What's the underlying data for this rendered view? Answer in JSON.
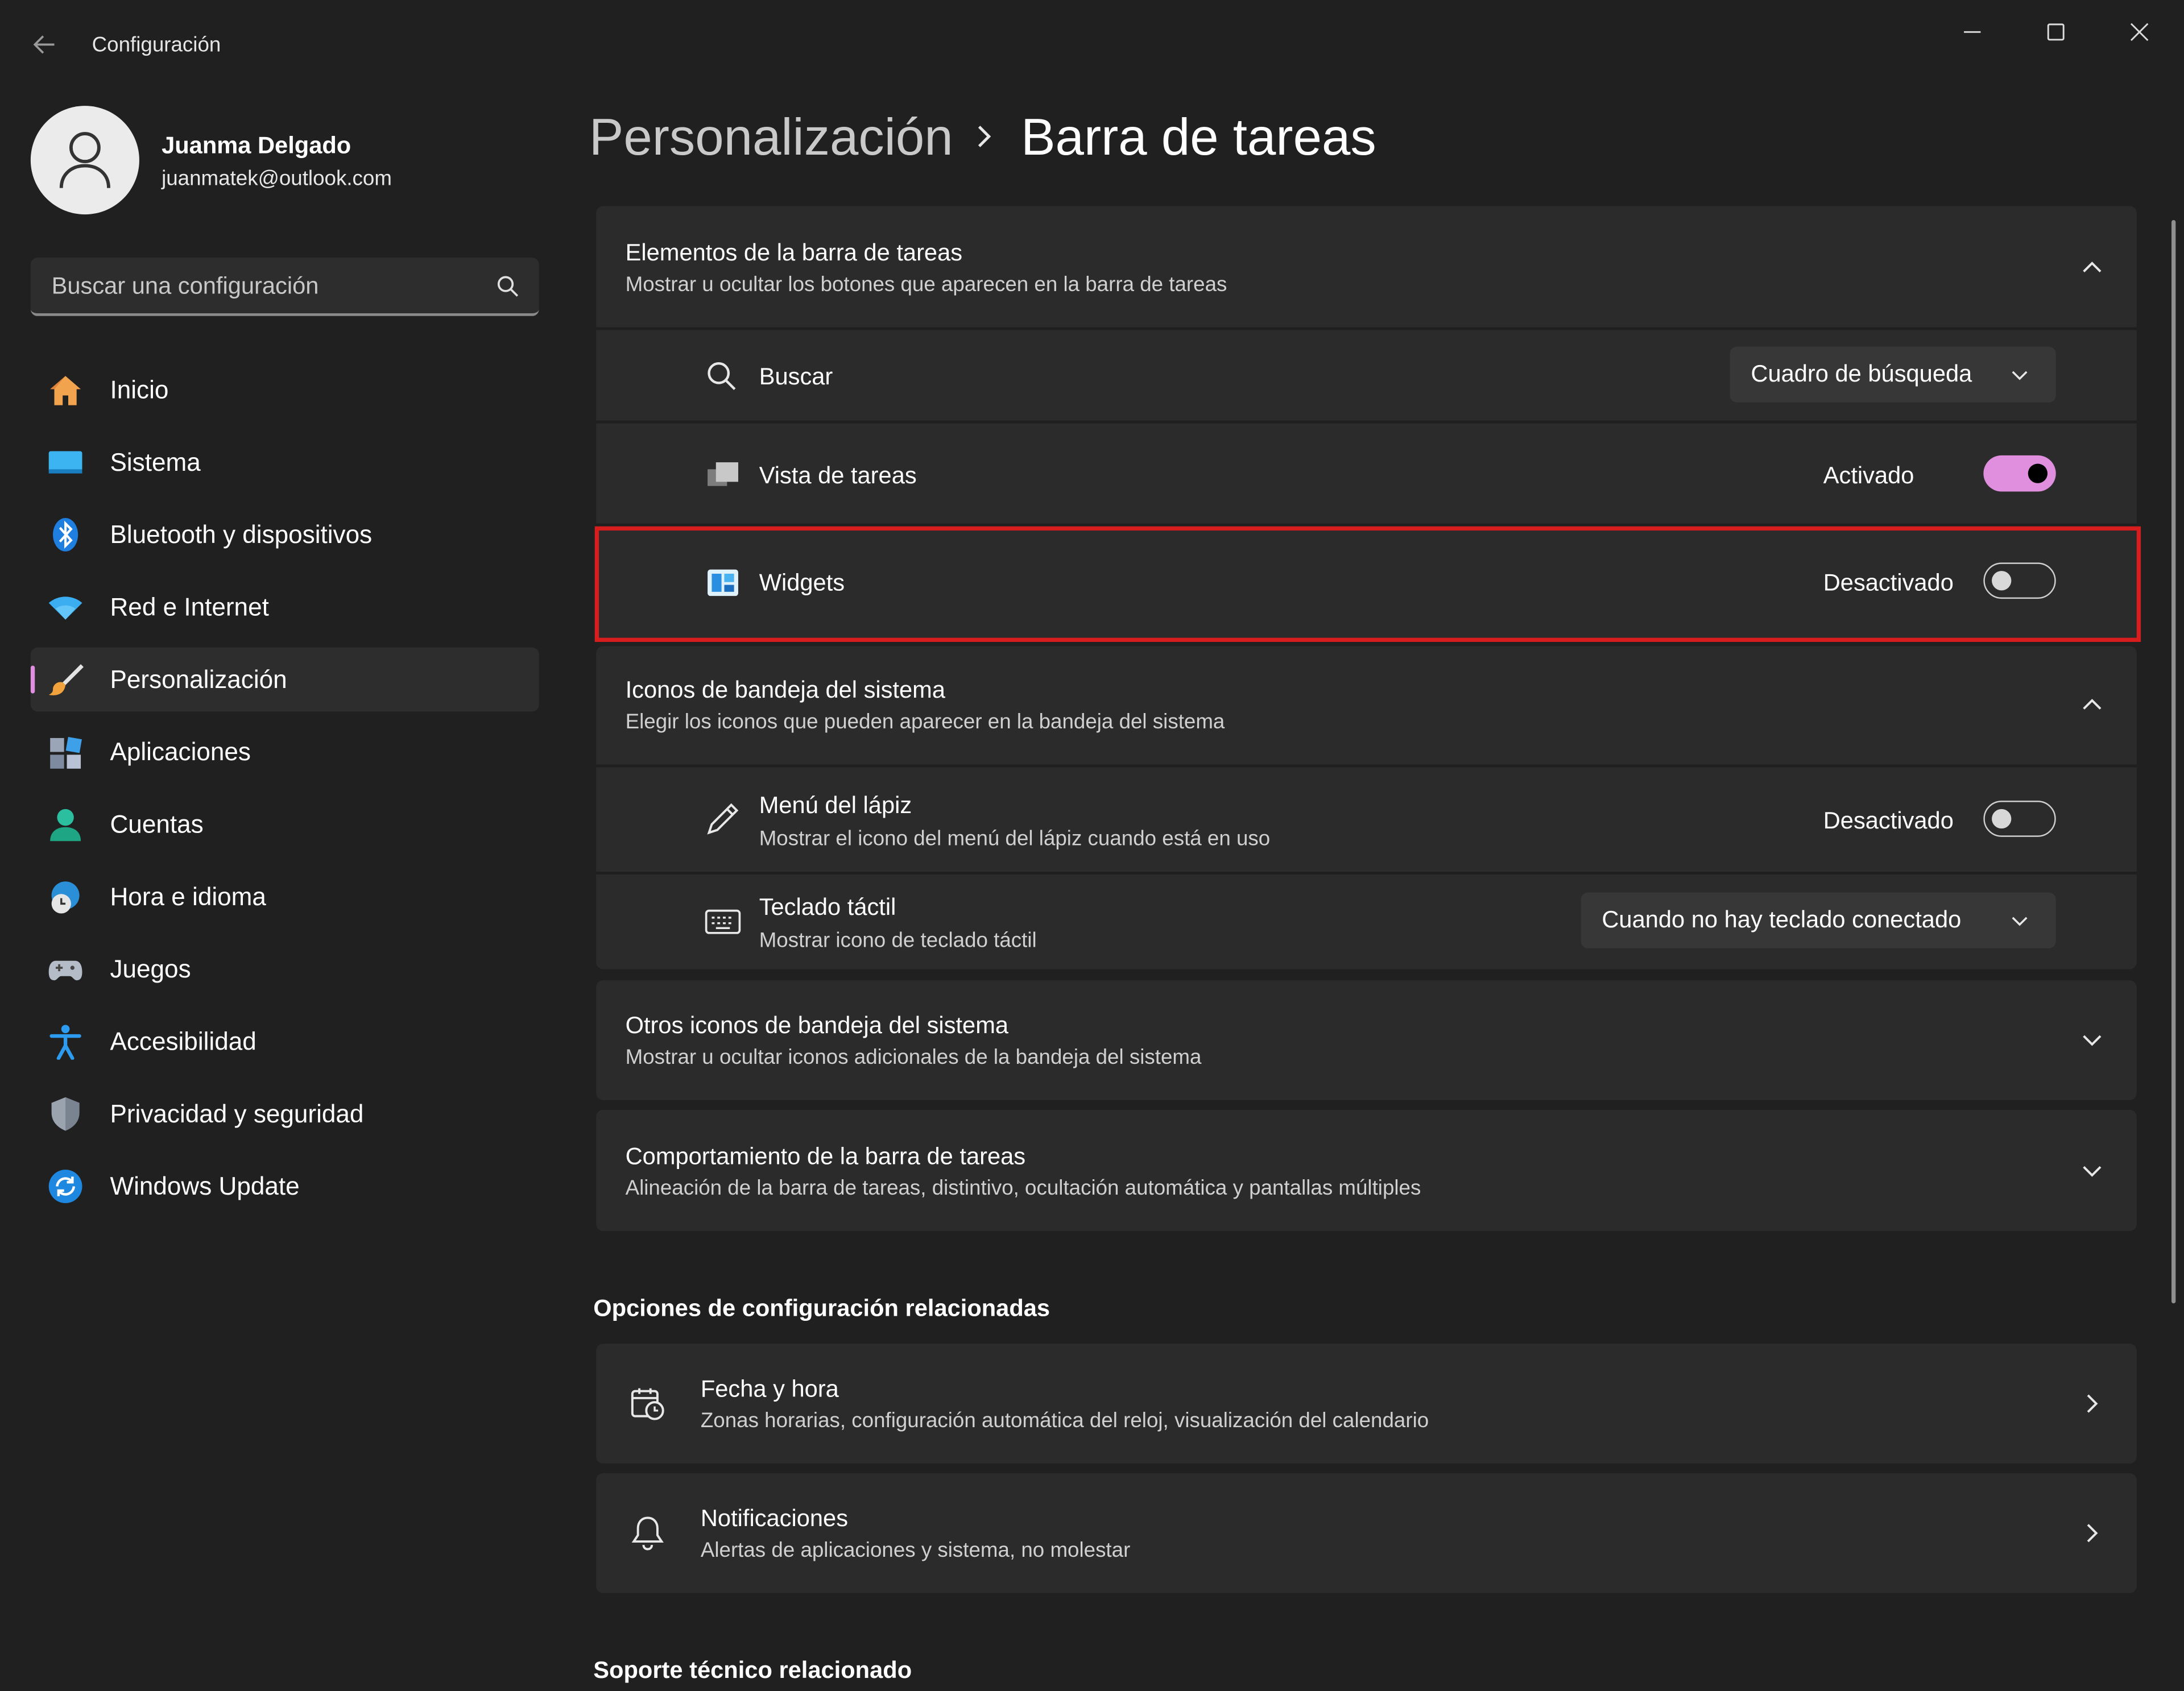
{
  "window": {
    "title": "Configuración",
    "controls": [
      "minimize",
      "maximize",
      "close"
    ]
  },
  "user": {
    "name": "Juanma Delgado",
    "email": "juanmatek@outlook.com"
  },
  "search": {
    "placeholder": "Buscar una configuración"
  },
  "sidebar": {
    "active_index": 4,
    "items": [
      {
        "label": "Inicio",
        "icon": "home-icon"
      },
      {
        "label": "Sistema",
        "icon": "system-icon"
      },
      {
        "label": "Bluetooth y dispositivos",
        "icon": "bluetooth-icon"
      },
      {
        "label": "Red e Internet",
        "icon": "wifi-icon"
      },
      {
        "label": "Personalización",
        "icon": "brush-icon"
      },
      {
        "label": "Aplicaciones",
        "icon": "apps-icon"
      },
      {
        "label": "Cuentas",
        "icon": "account-icon"
      },
      {
        "label": "Hora e idioma",
        "icon": "time-language-icon"
      },
      {
        "label": "Juegos",
        "icon": "gamepad-icon"
      },
      {
        "label": "Accesibilidad",
        "icon": "accessibility-icon"
      },
      {
        "label": "Privacidad y seguridad",
        "icon": "shield-icon"
      },
      {
        "label": "Windows Update",
        "icon": "update-icon"
      }
    ]
  },
  "breadcrumb": {
    "parent": "Personalización",
    "current": "Barra de tareas"
  },
  "taskbar_items": {
    "title": "Elementos de la barra de tareas",
    "subtitle": "Mostrar u ocultar los botones que aparecen en la barra de tareas",
    "search": {
      "label": "Buscar",
      "value": "Cuadro de búsqueda"
    },
    "task_view": {
      "label": "Vista de tareas",
      "state": "Activado"
    },
    "widgets": {
      "label": "Widgets",
      "state": "Desactivado"
    }
  },
  "tray_icons": {
    "title": "Iconos de bandeja del sistema",
    "subtitle": "Elegir los iconos que pueden aparecer en la bandeja del sistema",
    "pen_menu": {
      "label": "Menú del lápiz",
      "subtitle": "Mostrar el icono del menú del lápiz cuando está en uso",
      "state": "Desactivado"
    },
    "touch_keyboard": {
      "label": "Teclado táctil",
      "subtitle": "Mostrar icono de teclado táctil",
      "value": "Cuando no hay teclado conectado"
    }
  },
  "other_tray": {
    "title": "Otros iconos de bandeja del sistema",
    "subtitle": "Mostrar u ocultar iconos adicionales de la bandeja del sistema"
  },
  "behavior": {
    "title": "Comportamiento de la barra de tareas",
    "subtitle": "Alineación de la barra de tareas, distintivo, ocultación automática y pantallas múltiples"
  },
  "related": {
    "title": "Opciones de configuración relacionadas",
    "items": [
      {
        "title": "Fecha y hora",
        "subtitle": "Zonas horarias, configuración automática del reloj, visualización del calendario",
        "icon": "calendar-clock-icon"
      },
      {
        "title": "Notificaciones",
        "subtitle": "Alertas de aplicaciones y sistema, no molestar",
        "icon": "bell-icon"
      }
    ]
  },
  "support": {
    "title": "Soporte técnico relacionado"
  },
  "colors": {
    "background": "#202020",
    "card": "#2b2b2b",
    "accent": "#e08fde",
    "highlight": "#d71d1d"
  }
}
